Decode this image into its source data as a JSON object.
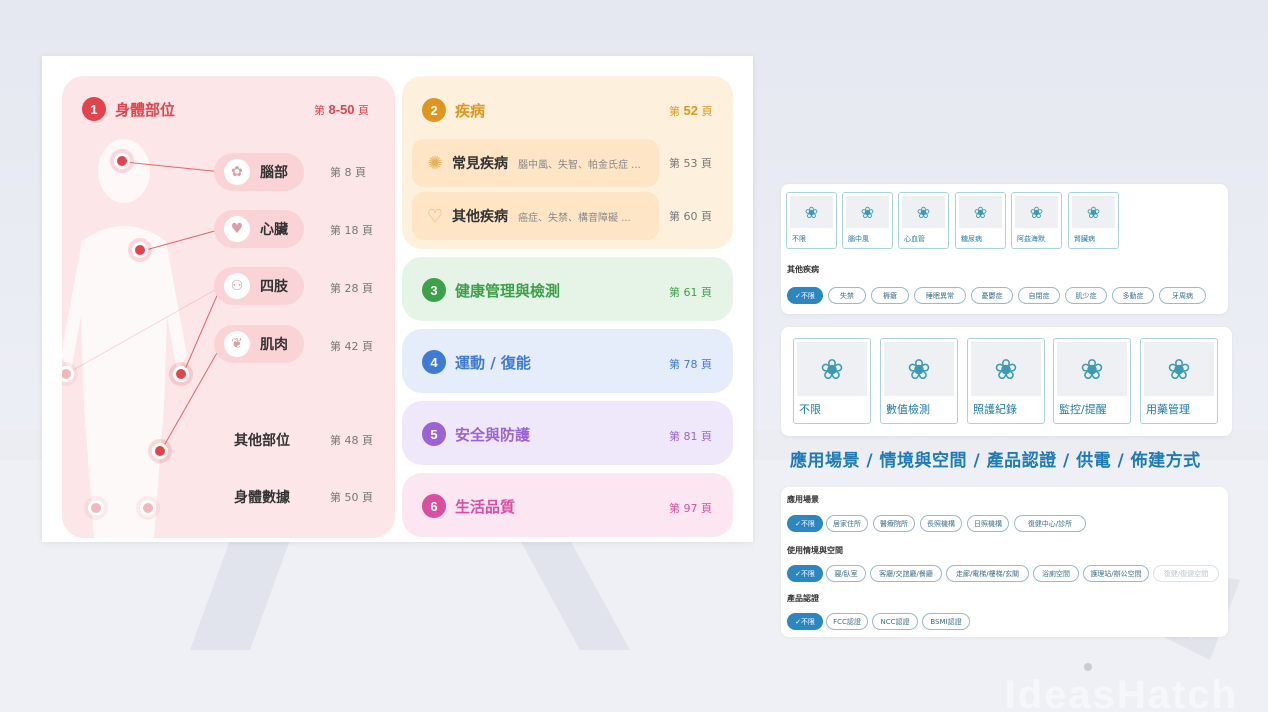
{
  "body_section": {
    "number": "1",
    "title": "身體部位",
    "pages": {
      "prefix": "第 ",
      "value": "8-50",
      "suffix": " 頁"
    },
    "parts": [
      {
        "label": "腦部",
        "page": "第  8  頁",
        "icon": "brain-icon"
      },
      {
        "label": "心臟",
        "page": "第 18 頁",
        "icon": "heart-icon"
      },
      {
        "label": "四肢",
        "page": "第 28 頁",
        "icon": "joint-icon"
      },
      {
        "label": "肌肉",
        "page": "第 42 頁",
        "icon": "muscle-icon"
      }
    ],
    "others": [
      {
        "label": "其他部位",
        "page": "第 48 頁"
      },
      {
        "label": "身體數據",
        "page": "第 50 頁"
      }
    ]
  },
  "categories": [
    {
      "number": "2",
      "title": "疾病",
      "page_prefix": "第 ",
      "page_value": "52",
      "page_suffix": " 頁",
      "color": "#e0951e",
      "bg": "#fdf1de",
      "sub": [
        {
          "title": "常見疾病",
          "desc": "腦中風、失智、帕金氏症 ...",
          "page": "第 53 頁",
          "icon": "virus-icon"
        },
        {
          "title": "其他疾病",
          "desc": "癌症、失禁、構音障礙 ...",
          "page": "第 60 頁",
          "icon": "heart-hand-icon"
        }
      ]
    },
    {
      "number": "3",
      "title": "健康管理與檢測",
      "page": "第 61 頁",
      "color": "#3ea04a",
      "bg": "#e5f4e6"
    },
    {
      "number": "4",
      "title": "運動 / 復能",
      "page": "第 78 頁",
      "color": "#3f7ad3",
      "bg": "#e5ecfa"
    },
    {
      "number": "5",
      "title": "安全與防護",
      "page": "第 81 頁",
      "color": "#9b63d4",
      "bg": "#efe8fb"
    },
    {
      "number": "6",
      "title": "生活品質",
      "page": "第 97 頁",
      "color": "#d94fa0",
      "bg": "#fce6f1"
    }
  ],
  "disease_filter": {
    "tiles": [
      "不限",
      "腦中風",
      "心血管",
      "糖尿病",
      "阿茲海默",
      "腎臟病"
    ],
    "other_label": "其他疾病",
    "chips": [
      "不限",
      "失禁",
      "褥瘡",
      "睡眠異常",
      "憂鬱症",
      "自閉症",
      "肌少症",
      "多動症",
      "牙周病"
    ]
  },
  "function_tiles": [
    "不限",
    "數值檢測",
    "照護紀錄",
    "監控/提醒",
    "用藥管理"
  ],
  "scenario_title": "應用場景 / 情境與空間 / 產品認證 / 供電 / 佈建方式",
  "scenario_filter": {
    "groups": [
      {
        "label": "應用場景",
        "chips": [
          "不限",
          "居家住所",
          "醫療院所",
          "長照機構",
          "日照機構",
          "復健中心/診所"
        ]
      },
      {
        "label": "使用情境與空間",
        "chips": [
          "不限",
          "寢/臥室",
          "客廳/交誼廳/餐廳",
          "走廊/電梯/樓梯/玄關",
          "浴廁空間",
          "護理站/辦公空間",
          "復健/復健空間"
        ]
      },
      {
        "label": "產品認證",
        "chips": [
          "不限",
          "FCC認證",
          "NCC認證",
          "BSMI認證"
        ]
      }
    ]
  },
  "watermark": "IdeasHatch"
}
